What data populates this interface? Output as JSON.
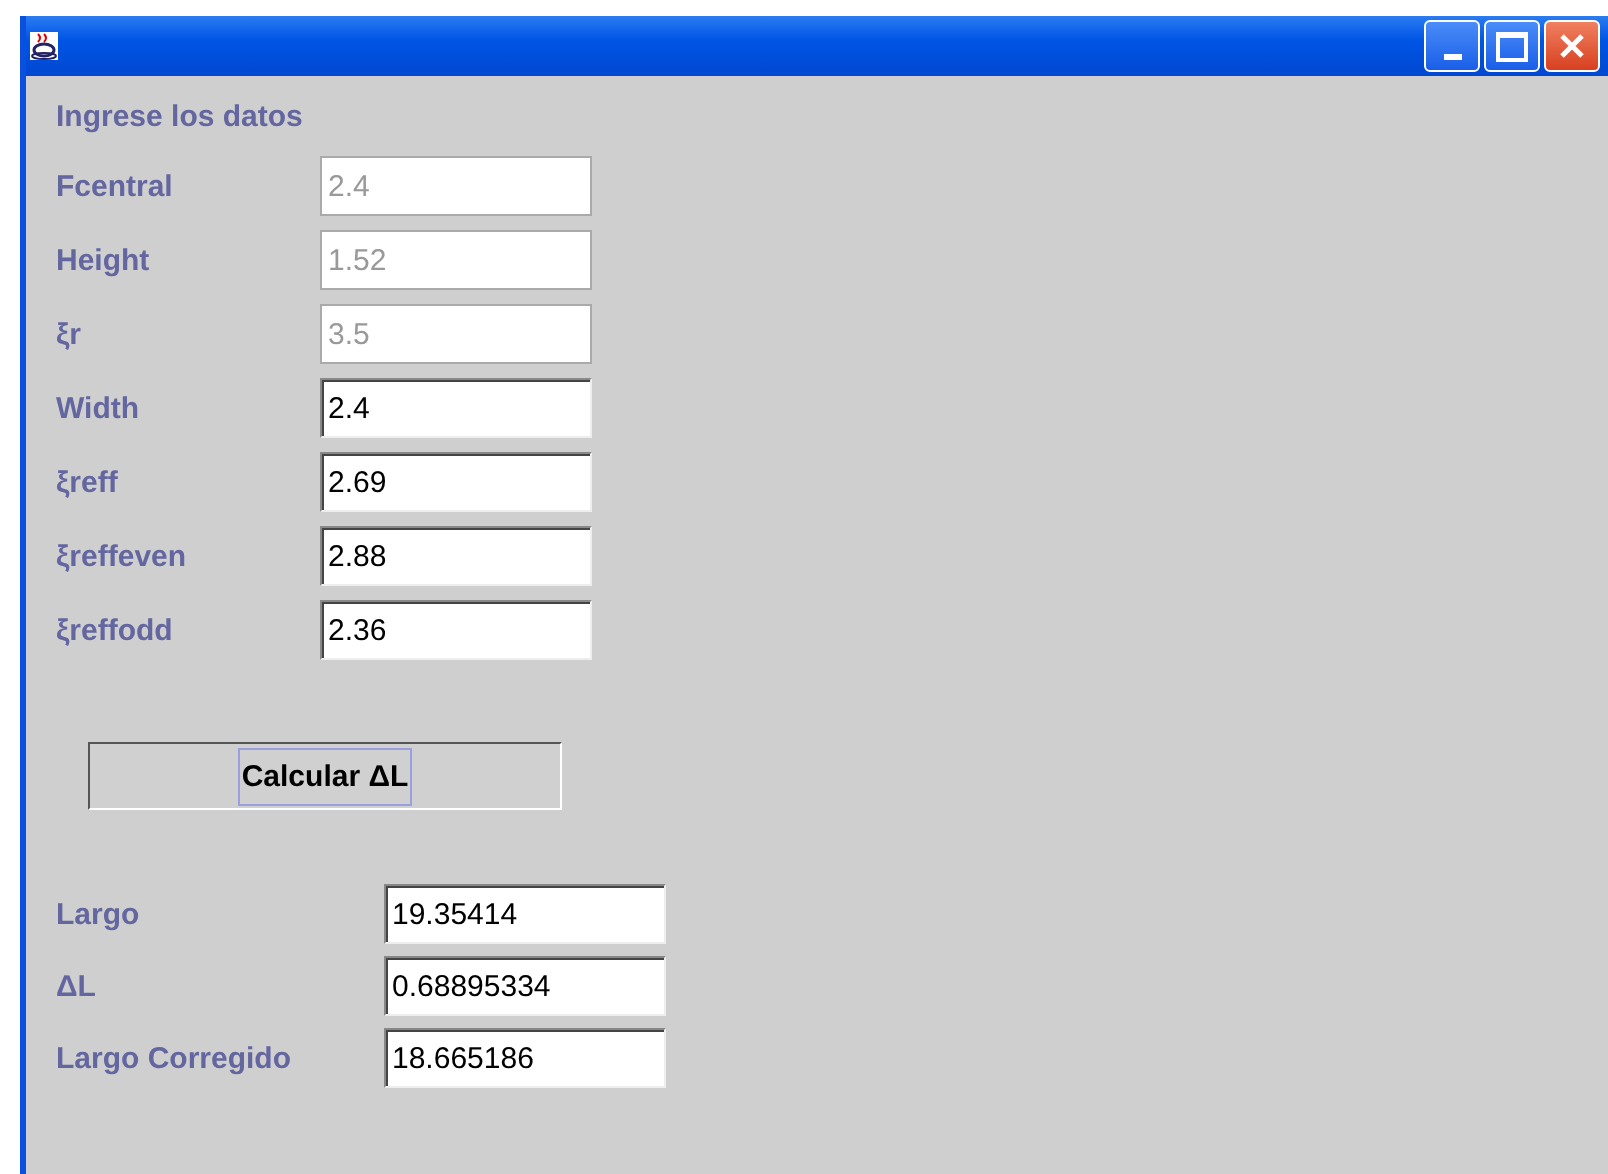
{
  "inputs": {
    "heading": "Ingrese los datos",
    "fields": [
      {
        "label": "Fcentral",
        "value": "2.4",
        "disabled": true
      },
      {
        "label": "Height",
        "value": "1.52",
        "disabled": true
      },
      {
        "label": "ξr",
        "value": "3.5",
        "disabled": true
      },
      {
        "label": "Width",
        "value": "2.4",
        "disabled": false
      },
      {
        "label": "ξreff",
        "value": "2.69",
        "disabled": false
      },
      {
        "label": "ξreffeven",
        "value": "2.88",
        "disabled": false
      },
      {
        "label": "ξreffodd",
        "value": "2.36",
        "disabled": false
      }
    ]
  },
  "button": {
    "label": "Calcular ΔL"
  },
  "results": [
    {
      "label": "Largo",
      "value": "19.35414"
    },
    {
      "label": "ΔL",
      "value": "0.68895334"
    },
    {
      "label": "Largo Corregido",
      "value": "18.665186"
    }
  ]
}
